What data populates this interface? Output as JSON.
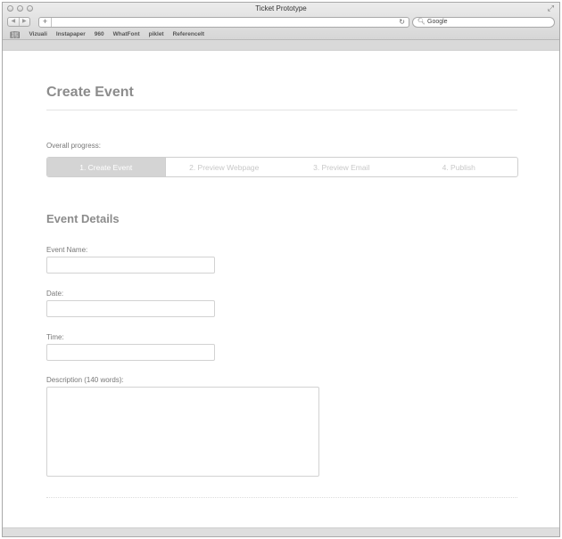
{
  "window": {
    "title": "Ticket Prototype"
  },
  "toolbar": {
    "search_placeholder": "Google"
  },
  "bookmarks": [
    "Vizuali",
    "Instapaper",
    "960",
    "WhatFont",
    "piklet",
    "ReferenceIt"
  ],
  "page": {
    "heading": "Create Event",
    "progress_label": "Overall progress:",
    "steps": [
      {
        "label": "1. Create Event",
        "active": true
      },
      {
        "label": "2. Preview Webpage",
        "active": false
      },
      {
        "label": "3. Preview Email",
        "active": false
      },
      {
        "label": "4. Publish",
        "active": false
      }
    ],
    "section_heading": "Event Details",
    "fields": {
      "event_name_label": "Event Name:",
      "date_label": "Date:",
      "time_label": "Time:",
      "description_label": "Description (140 words):"
    }
  }
}
